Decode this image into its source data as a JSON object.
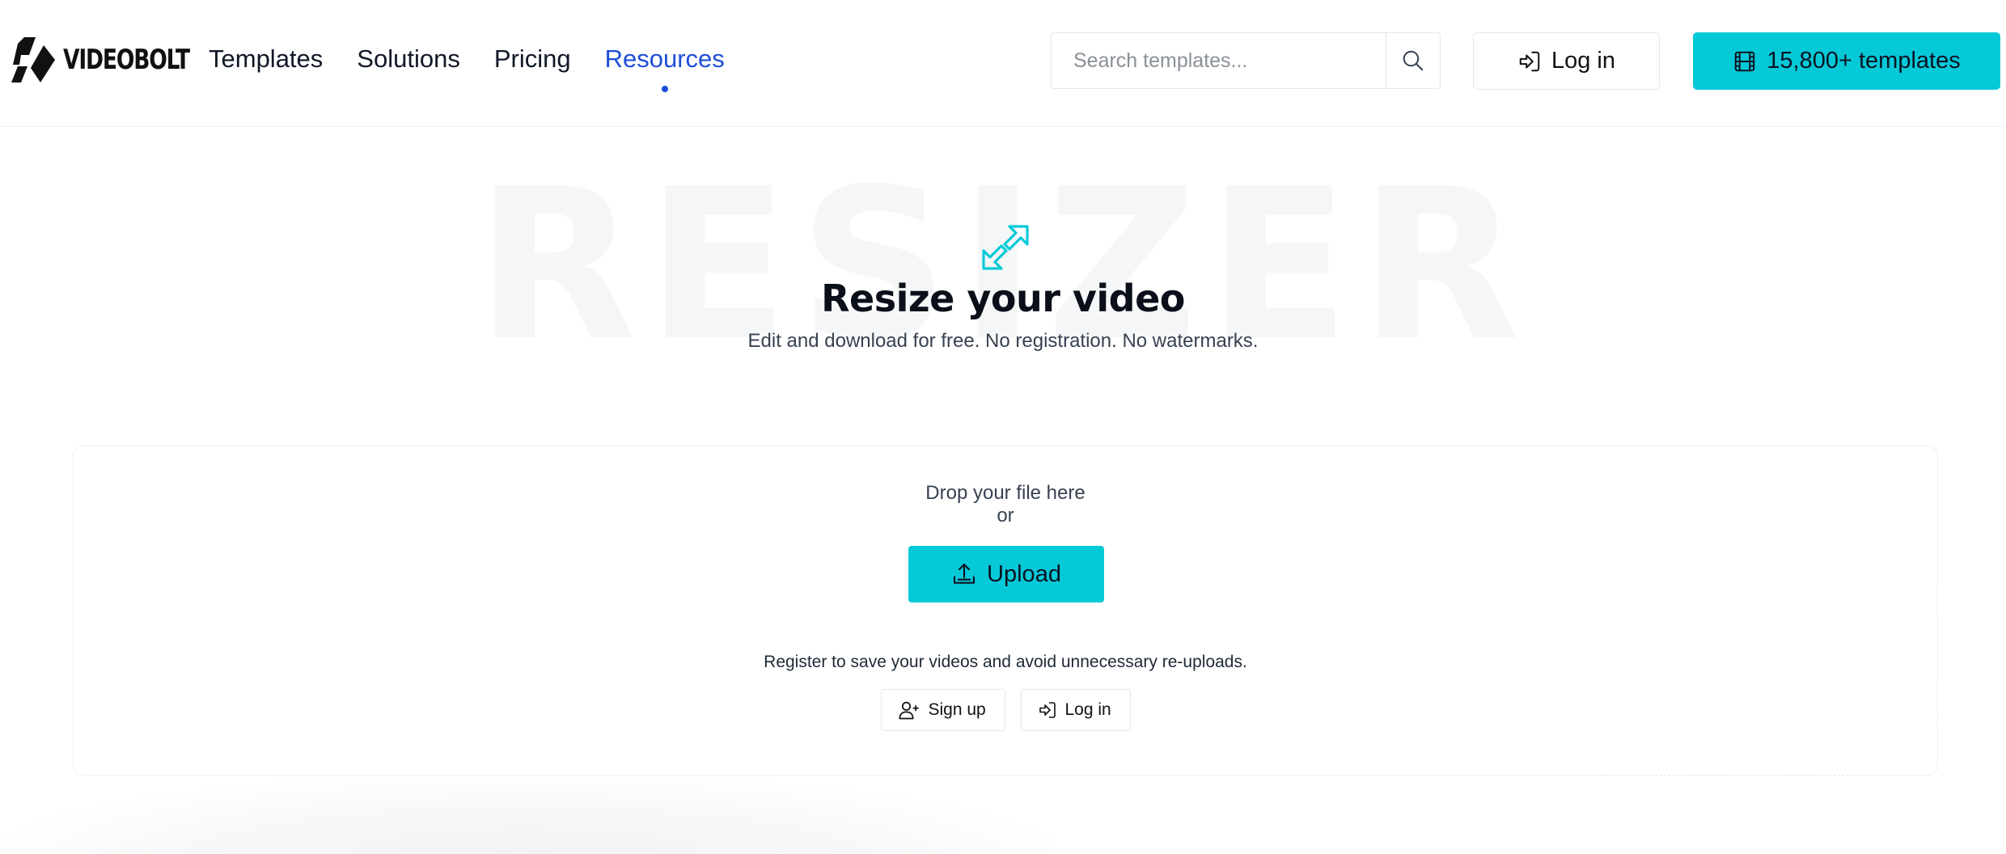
{
  "brand": {
    "name": "VIDEOBOLT"
  },
  "nav": {
    "items": [
      {
        "label": "Templates",
        "active": false
      },
      {
        "label": "Solutions",
        "active": false
      },
      {
        "label": "Pricing",
        "active": false
      },
      {
        "label": "Resources",
        "active": true
      }
    ]
  },
  "search": {
    "placeholder": "Search templates...",
    "value": ""
  },
  "header_actions": {
    "login_label": "Log in",
    "cta_label": "15,800+ templates"
  },
  "hero": {
    "background_word": "RESIZER",
    "title": "Resize your video",
    "subtitle": "Edit and download for free. No registration. No watermarks."
  },
  "dropzone": {
    "drop_line1": "Drop your file here",
    "drop_line2": "or",
    "upload_label": "Upload",
    "register_text": "Register to save your videos and avoid unnecessary re-uploads.",
    "signup_label": "Sign up",
    "login_label": "Log in"
  },
  "colors": {
    "accent": "#06c9d8",
    "nav_active": "#1d4ed8",
    "text": "#111827"
  },
  "icons": [
    "logo-mark-icon",
    "search-icon",
    "login-icon",
    "film-icon",
    "resize-arrows-icon",
    "upload-icon",
    "add-user-icon",
    "login-icon"
  ]
}
